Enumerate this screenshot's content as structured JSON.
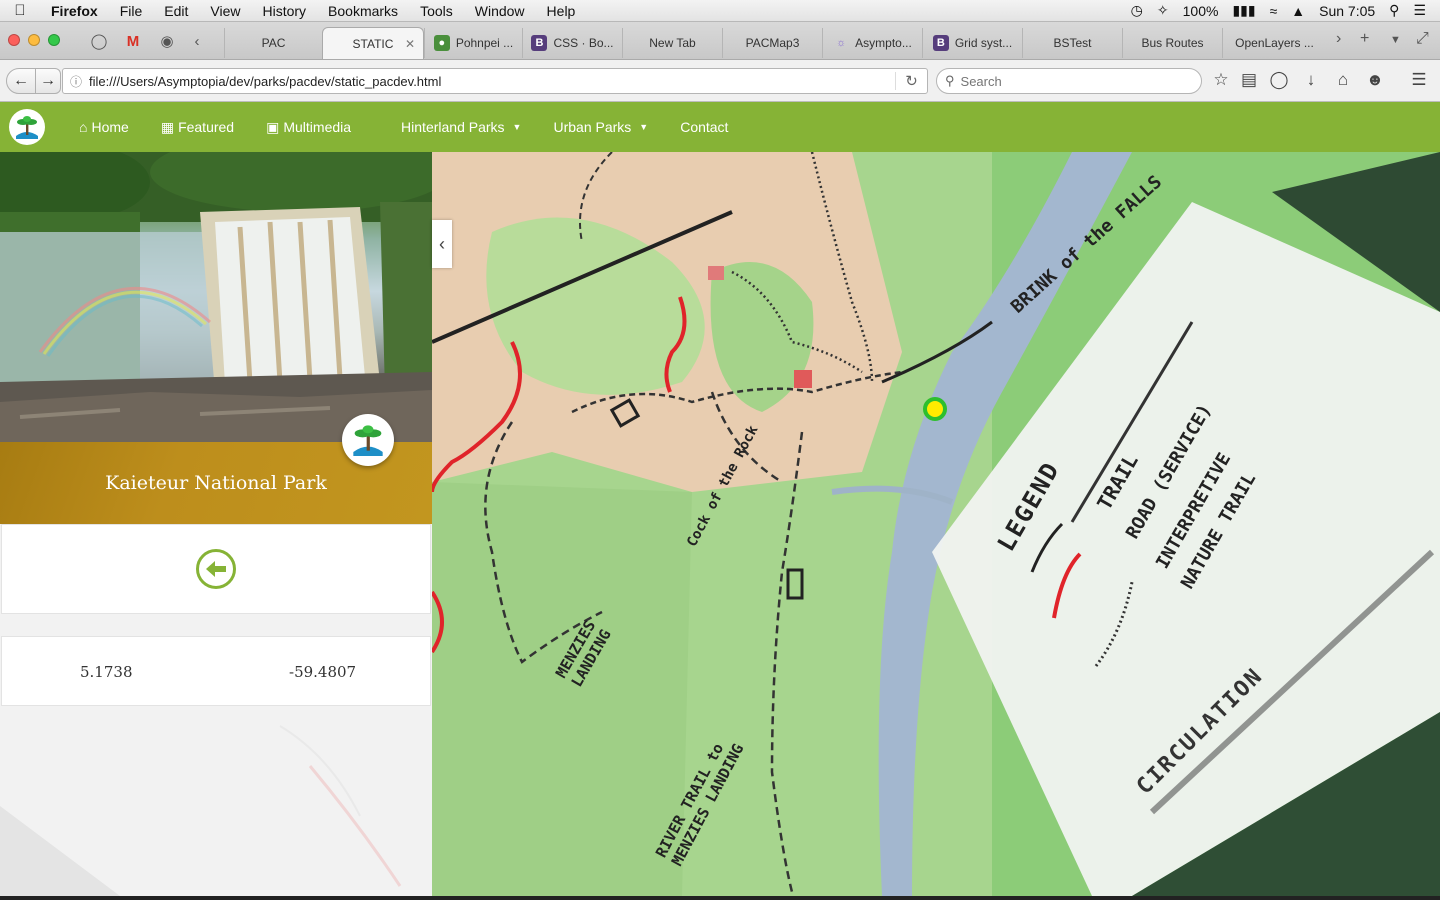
{
  "menubar": {
    "app_name": "Firefox",
    "items": [
      "File",
      "Edit",
      "View",
      "History",
      "Bookmarks",
      "Tools",
      "Window",
      "Help"
    ],
    "battery": "100%",
    "clock": "Sun 7:05"
  },
  "tabs": [
    {
      "label": "PAC",
      "active": false
    },
    {
      "label": "STATIC",
      "active": true
    },
    {
      "label": "Pohnpei ...",
      "active": false
    },
    {
      "label": "CSS · Bo...",
      "active": false
    },
    {
      "label": "New Tab",
      "active": false
    },
    {
      "label": "PACMap3",
      "active": false
    },
    {
      "label": "Asympto...",
      "active": false
    },
    {
      "label": "Grid syst...",
      "active": false
    },
    {
      "label": "BSTest",
      "active": false
    },
    {
      "label": "Bus Routes",
      "active": false
    },
    {
      "label": "OpenLayers ...",
      "active": false
    }
  ],
  "toolbar": {
    "url": "file:///Users/Asymptopia/dev/parks/pacdev/static_pacdev.html",
    "search_placeholder": "Search"
  },
  "sitenav": {
    "home": "Home",
    "featured": "Featured",
    "multimedia": "Multimedia",
    "hinterland": "Hinterland Parks",
    "urban": "Urban Parks",
    "contact": "Contact"
  },
  "park": {
    "title": "Kaieteur National Park",
    "latitude": "5.1738",
    "longitude": "-59.4807"
  },
  "map": {
    "labels": {
      "brink": "BRINK of the FALLS",
      "cock": "Cock of the Rock",
      "menzies": "MENZIES LANDING",
      "river": "RIVER TRAIL to MENZIES LANDING",
      "legend": "LEGEND",
      "trail": "TRAIL",
      "road": "ROAD (SERVICE)",
      "interp1": "INTERPRETIVE",
      "interp2": "NATURE TRAIL",
      "circulation": "CIRCULATION"
    },
    "marker_color": "#ffeb00",
    "marker_ring": "#2dbf2d"
  },
  "colors": {
    "nav_green": "#86b336",
    "title_gold": "#bd8e1c"
  }
}
